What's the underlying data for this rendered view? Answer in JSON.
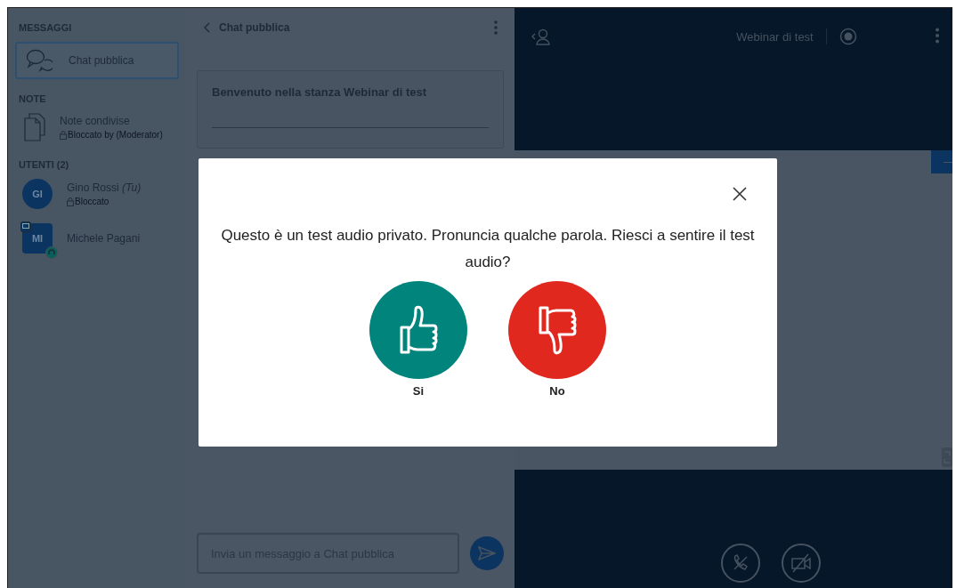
{
  "sidebar": {
    "messages_title": "MESSAGGI",
    "chats": [
      {
        "label": "Chat pubblica",
        "selected": true
      }
    ],
    "notes_title": "NOTE",
    "notes": [
      {
        "label": "Note condivise",
        "status": "Bloccato by (Moderator)"
      }
    ],
    "users_title": "UTENTI (2)",
    "users": [
      {
        "initials": "GI",
        "name": "Gino Rossi *(Tu)*",
        "status": "Bloccato",
        "presenter": false,
        "audio": false
      },
      {
        "initials": "MI",
        "name": "Michele Pagani",
        "presenter": true,
        "audio": true
      }
    ]
  },
  "chat": {
    "title": "Chat pubblica",
    "welcome": "Benvenuto nella stanza Webinar di test",
    "input": {
      "placeholder": "Invia un messaggio a Chat pubblica"
    }
  },
  "meeting": {
    "title": "Webinar di test"
  },
  "modal": {
    "message": "Questo è un test audio privato. Pronuncia qualche parola. Riesci a sentire il test audio?",
    "buttons": [
      {
        "kind": "yes",
        "label": "Si"
      },
      {
        "kind": "no",
        "label": "No"
      }
    ]
  }
}
